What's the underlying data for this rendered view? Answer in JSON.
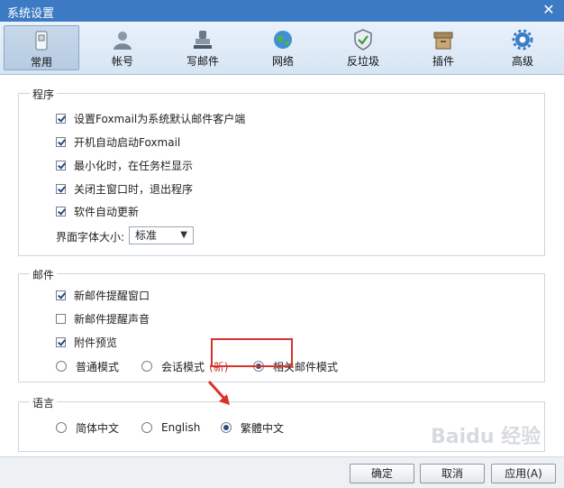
{
  "window": {
    "title": "系统设置"
  },
  "toolbar": {
    "items": [
      {
        "label": "常用",
        "icon": "phone-settings-icon",
        "active": true
      },
      {
        "label": "帐号",
        "icon": "user-icon",
        "active": false
      },
      {
        "label": "写邮件",
        "icon": "stamp-icon",
        "active": false
      },
      {
        "label": "网络",
        "icon": "globe-icon",
        "active": false
      },
      {
        "label": "反垃圾",
        "icon": "shield-icon",
        "active": false
      },
      {
        "label": "插件",
        "icon": "box-icon",
        "active": false
      },
      {
        "label": "高级",
        "icon": "gear-icon",
        "active": false
      }
    ]
  },
  "program": {
    "title": "程序",
    "options": [
      {
        "label": "设置Foxmail为系统默认邮件客户端",
        "checked": true
      },
      {
        "label": "开机自动启动Foxmail",
        "checked": true
      },
      {
        "label": "最小化时，在任务栏显示",
        "checked": true
      },
      {
        "label": "关闭主窗口时，退出程序",
        "checked": true
      },
      {
        "label": "软件自动更新",
        "checked": true
      }
    ],
    "font_size_label": "界面字体大小:",
    "font_size_value": "标准"
  },
  "mail": {
    "title": "邮件",
    "options": [
      {
        "label": "新邮件提醒窗口",
        "checked": true
      },
      {
        "label": "新邮件提醒声音",
        "checked": false
      },
      {
        "label": "附件预览",
        "checked": true
      }
    ],
    "modes": [
      {
        "label": "普通模式",
        "selected": false
      },
      {
        "label": "会话模式",
        "selected": false,
        "tag": "(新)"
      },
      {
        "label": "相关邮件模式",
        "selected": true
      }
    ]
  },
  "language": {
    "title": "语言",
    "options": [
      {
        "label": "简体中文",
        "selected": false
      },
      {
        "label": "English",
        "selected": false
      },
      {
        "label": "繁體中文",
        "selected": true
      }
    ]
  },
  "buttons": {
    "ok": "确定",
    "cancel": "取消",
    "apply": "应用(A)"
  },
  "watermark": "Baidu 经验",
  "colors": {
    "titlebar": "#3d7ac4",
    "highlight": "#d9312b",
    "accent": "#2a4a80"
  }
}
